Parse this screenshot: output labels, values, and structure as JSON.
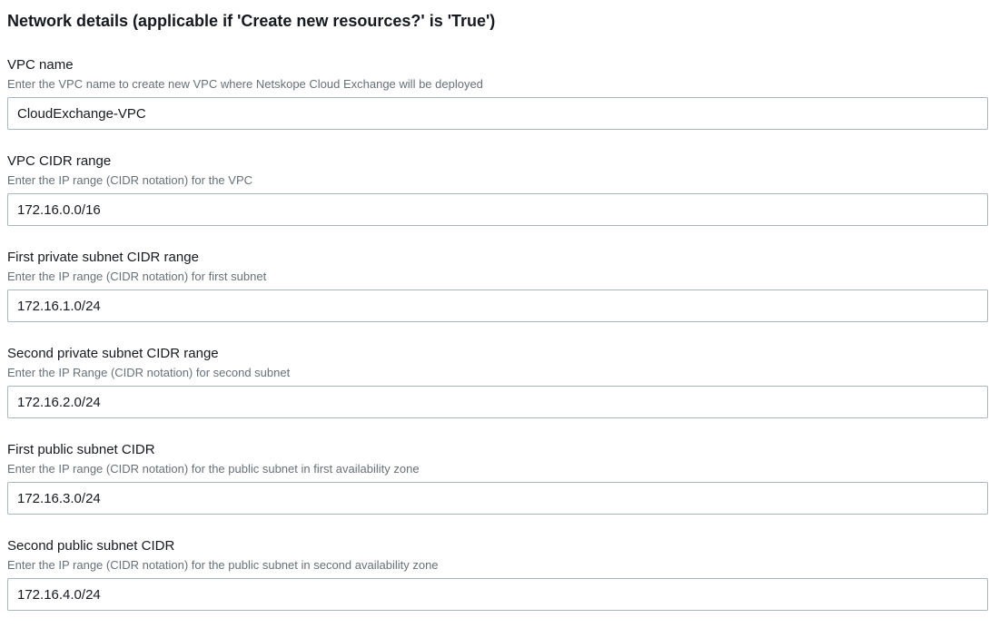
{
  "section": {
    "title": "Network details (applicable if 'Create new resources?' is 'True')"
  },
  "fields": [
    {
      "label": "VPC name",
      "description": "Enter the VPC name to create new VPC where Netskope Cloud Exchange will be deployed",
      "value": "CloudExchange-VPC"
    },
    {
      "label": "VPC CIDR range",
      "description": "Enter the IP range (CIDR notation) for the VPC",
      "value": "172.16.0.0/16"
    },
    {
      "label": "First private subnet CIDR range",
      "description": "Enter the IP range (CIDR notation) for first subnet",
      "value": "172.16.1.0/24"
    },
    {
      "label": "Second private subnet CIDR range",
      "description": "Enter the IP Range (CIDR notation) for second subnet",
      "value": "172.16.2.0/24"
    },
    {
      "label": "First public subnet CIDR",
      "description": "Enter the IP range (CIDR notation) for the public subnet in first availability zone",
      "value": "172.16.3.0/24"
    },
    {
      "label": "Second public subnet CIDR",
      "description": "Enter the IP range (CIDR notation) for the public subnet in second availability zone",
      "value": "172.16.4.0/24"
    }
  ]
}
